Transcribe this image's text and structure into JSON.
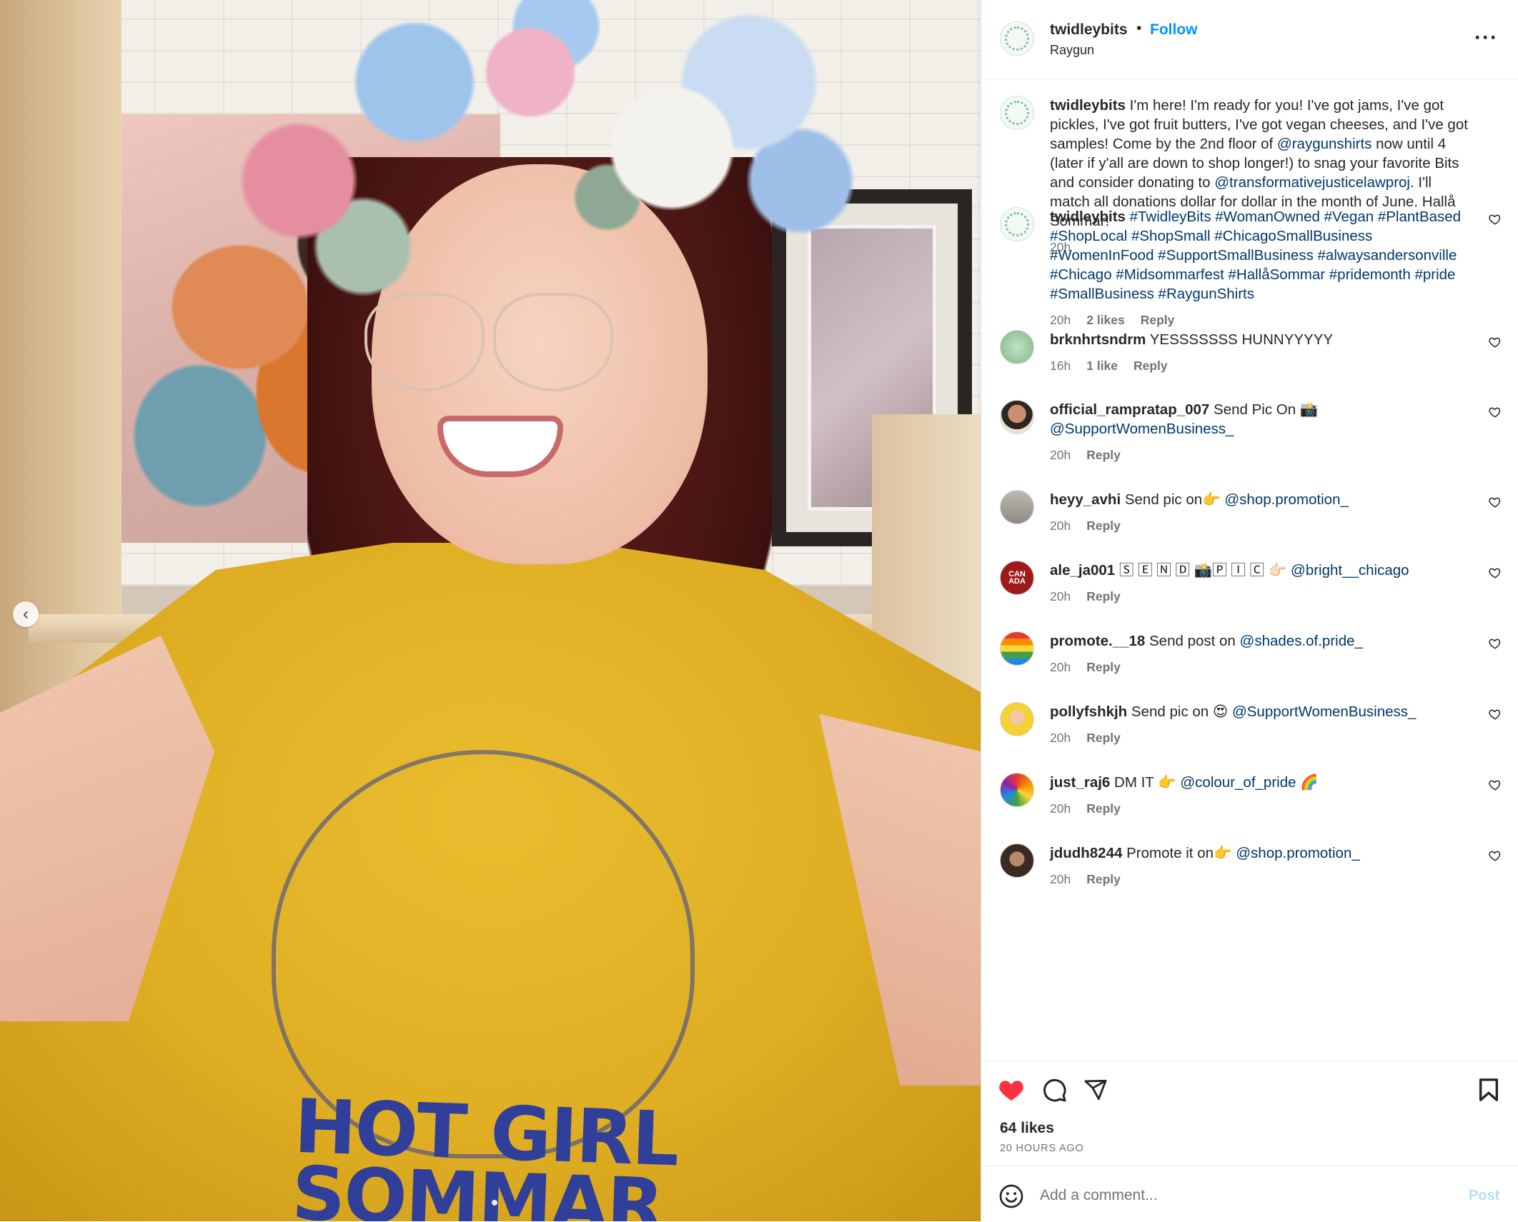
{
  "post": {
    "username": "twidleybits",
    "separator": "•",
    "follow_label": "Follow",
    "location": "Raygun",
    "more_icon": "more-horizontal-icon",
    "avatar_text": "twidley bits"
  },
  "photo": {
    "shirt_text_line1": "HOT GIRL",
    "shirt_text_line2": "SOMMAR",
    "prev_icon": "chevron-left-icon"
  },
  "caption": {
    "username": "twidleybits",
    "text_part1": " I'm here! I'm ready for you! I've got jams, I've got pickles, I've got fruit butters, I've got vegan cheeses, and I've got samples! Come by the 2nd floor of ",
    "mention1": "@raygunshirts",
    "text_part2": " now until 4 (later if y'all are down to shop longer!) to snag your favorite Bits and consider donating to ",
    "mention2": "@transformativejusticelawproj",
    "text_part3": ". I'll match all donations dollar for dollar in the month of June. Hallå Sommar!",
    "time": "20h"
  },
  "comments": [
    {
      "username": "twidleybits",
      "text": "",
      "link": "#TwidleyBits #WomanOwned #Vegan #PlantBased #ShopLocal #ShopSmall #ChicagoSmallBusiness #WomenInFood #SupportSmallBusiness #alwaysandersonville #Chicago #Midsommarfest #HallåSommar #pridemonth #pride #SmallBusiness #RaygunShirts",
      "time": "20h",
      "likes": "2 likes",
      "reply": "Reply"
    },
    {
      "username": "brknhrtsndrm",
      "text": " YESSSSSSS HUNNYYYYY",
      "link": "",
      "time": "16h",
      "likes": "1 like",
      "reply": "Reply"
    },
    {
      "username": "official_rampratap_007",
      "text": " Send Pic On 📸 ",
      "link": "@SupportWomenBusiness_",
      "time": "20h",
      "likes": "",
      "reply": "Reply"
    },
    {
      "username": "heyy_avhi",
      "text": " Send pic on👉 ",
      "link": "@shop.promotion_",
      "time": "20h",
      "likes": "",
      "reply": "Reply"
    },
    {
      "username": "ale_ja001",
      "text": " 🅂 🄴 🄽 🄳 📸🄿 🄸 🄲 👉🏻 ",
      "link": "@bright__chicago",
      "time": "20h",
      "likes": "",
      "reply": "Reply"
    },
    {
      "username": "promote.__18",
      "text": " Send post on ",
      "link": "@shades.of.pride_",
      "time": "20h",
      "likes": "",
      "reply": "Reply"
    },
    {
      "username": "pollyfshkjh",
      "text": " Send pic on 😍 ",
      "link": "@SupportWomenBusiness_",
      "time": "20h",
      "likes": "",
      "reply": "Reply"
    },
    {
      "username": "just_raj6",
      "text": " DM IT 👉 ",
      "link": "@colour_of_pride",
      "link_suffix": " 🌈",
      "time": "20h",
      "likes": "",
      "reply": "Reply"
    },
    {
      "username": "jdudh8244",
      "text": " Promote it on👉 ",
      "link": "@shop.promotion_",
      "time": "20h",
      "likes": "",
      "reply": "Reply"
    }
  ],
  "avatar_badge_canada": "CAN ADA",
  "actions": {
    "likes": "64 likes",
    "time_ago": "20 HOURS AGO",
    "like_icon": "heart-filled-icon",
    "comment_icon": "comment-icon",
    "share_icon": "share-icon",
    "save_icon": "bookmark-icon",
    "like_color": "#ff3040"
  },
  "composer": {
    "placeholder": "Add a comment...",
    "post_label": "Post",
    "emoji_icon": "emoji-icon"
  },
  "colors": {
    "link": "#00376b",
    "follow": "#0095f6",
    "meta": "#737373"
  }
}
